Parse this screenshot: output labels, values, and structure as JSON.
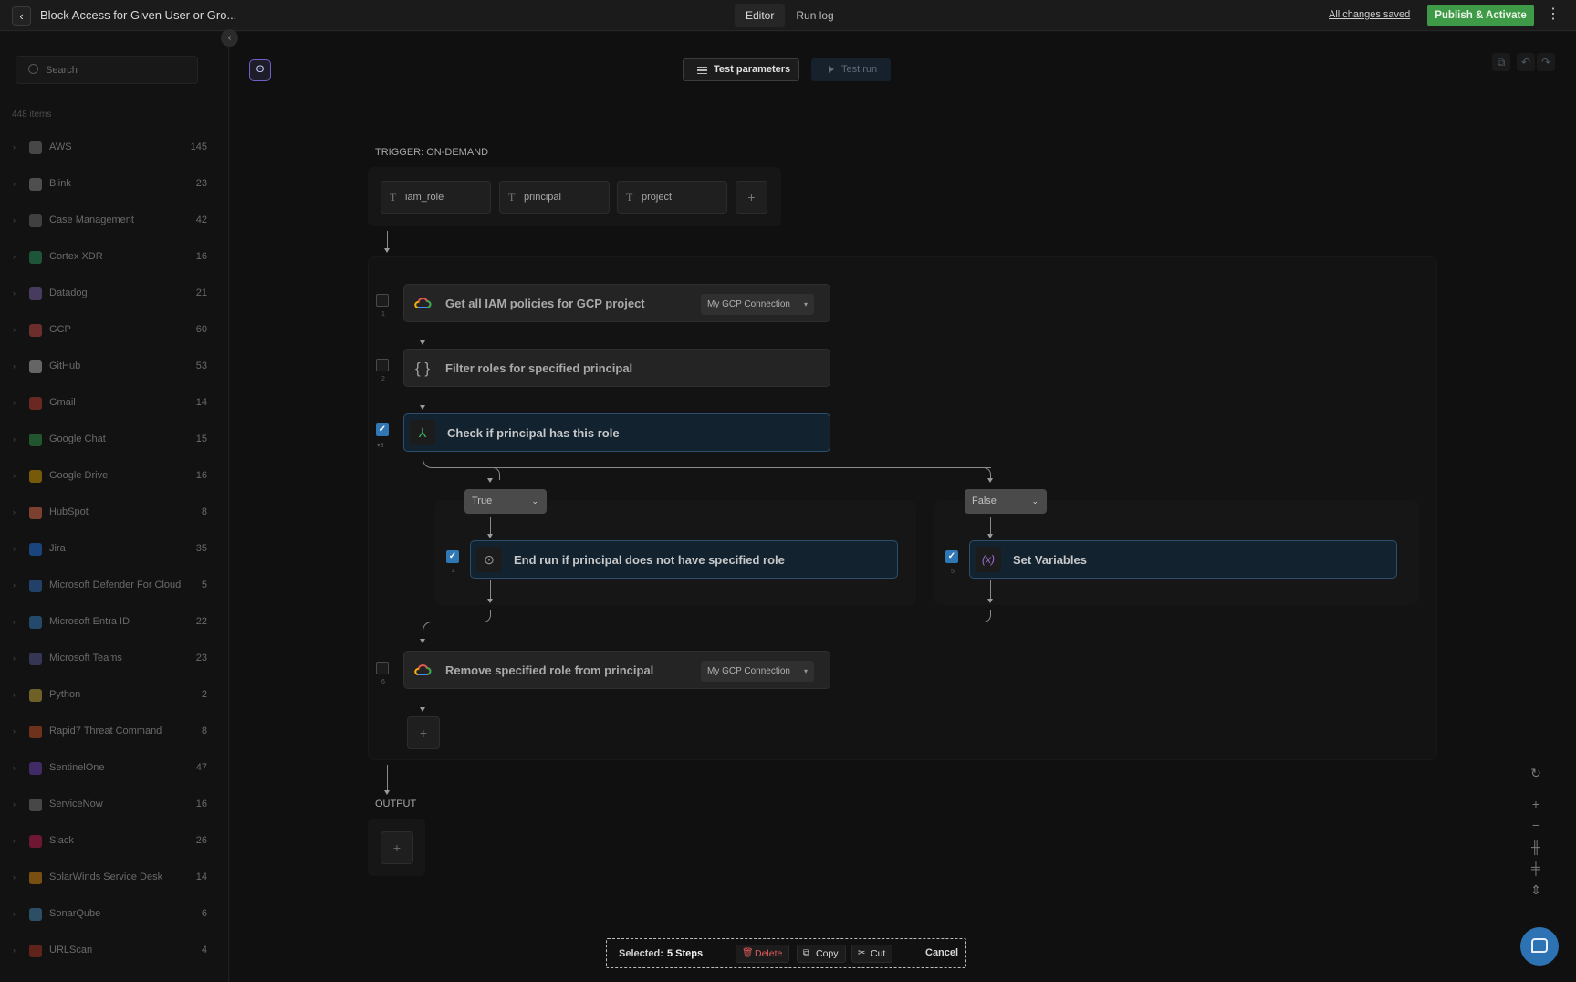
{
  "header": {
    "title": "Block Access for Given User or Gro...",
    "tabs": [
      {
        "label": "Editor",
        "active": true
      },
      {
        "label": "Run log",
        "active": false
      }
    ],
    "save_status": "All changes saved",
    "publish_label": "Publish & Activate",
    "publish_color": "#3f9a47",
    "more_icon": "⋮"
  },
  "sidebar": {
    "search_placeholder": "Search",
    "items_count": "448 items",
    "integrations": [
      {
        "name": "AWS",
        "count": "145",
        "color": "#8a8a8a"
      },
      {
        "name": "Blink",
        "count": "23",
        "color": "#9a9a9a"
      },
      {
        "name": "Case Management",
        "count": "42",
        "color": "#7a7a7a"
      },
      {
        "name": "Cortex XDR",
        "count": "16",
        "color": "#2fa86a"
      },
      {
        "name": "Datadog",
        "count": "21",
        "color": "#8a6fc0"
      },
      {
        "name": "GCP",
        "count": "60",
        "color": "#d9534f"
      },
      {
        "name": "GitHub",
        "count": "53",
        "color": "#cccccc"
      },
      {
        "name": "Gmail",
        "count": "14",
        "color": "#d44638"
      },
      {
        "name": "Google Chat",
        "count": "15",
        "color": "#34a853"
      },
      {
        "name": "Google Drive",
        "count": "16",
        "color": "#f4b400"
      },
      {
        "name": "HubSpot",
        "count": "8",
        "color": "#ff7a59"
      },
      {
        "name": "Jira",
        "count": "35",
        "color": "#2684ff"
      },
      {
        "name": "Microsoft Defender For Cloud",
        "count": "5",
        "color": "#3a7bd5"
      },
      {
        "name": "Microsoft Entra ID",
        "count": "22",
        "color": "#3b8fd9"
      },
      {
        "name": "Microsoft Teams",
        "count": "23",
        "color": "#6264a7"
      },
      {
        "name": "Python",
        "count": "2",
        "color": "#e0c040"
      },
      {
        "name": "Rapid7 Threat Command",
        "count": "8",
        "color": "#e05a2b"
      },
      {
        "name": "SentinelOne",
        "count": "47",
        "color": "#7b4bd1"
      },
      {
        "name": "ServiceNow",
        "count": "16",
        "color": "#8a8a8a"
      },
      {
        "name": "Slack",
        "count": "26",
        "color": "#e01e5a"
      },
      {
        "name": "SolarWinds Service Desk",
        "count": "14",
        "color": "#f39c12"
      },
      {
        "name": "SonarQube",
        "count": "6",
        "color": "#4e9bcd"
      },
      {
        "name": "URLScan",
        "count": "4",
        "color": "#c0392b"
      }
    ]
  },
  "canvas": {
    "test_parameters_label": "Test parameters",
    "test_run_label": "Test run",
    "trigger_label": "TRIGGER: ON-DEMAND",
    "trigger_params": [
      {
        "name": "iam_role"
      },
      {
        "name": "principal"
      },
      {
        "name": "project"
      }
    ],
    "add_symbol": "+",
    "steps": [
      {
        "num": "1",
        "label": "Get all IAM policies for GCP project",
        "connection": "My GCP Connection",
        "selected": false
      },
      {
        "num": "2",
        "label": "Filter roles for specified principal",
        "selected": false
      },
      {
        "num": "3",
        "label": "Check if principal has this role",
        "selected": true
      },
      {
        "num": "4",
        "label": "End run if principal does not have specified role",
        "selected": true
      },
      {
        "num": "5",
        "label": "Set Variables",
        "selected": true
      },
      {
        "num": "6",
        "label": "Remove specified role from principal",
        "connection": "My GCP Connection",
        "selected": false
      }
    ],
    "branches": [
      {
        "label": "True"
      },
      {
        "label": "False"
      }
    ],
    "output_label": "OUTPUT"
  },
  "selection_bar": {
    "selected_label": "Selected:",
    "selected_count": "5 Steps",
    "delete_label": "Delete",
    "copy_label": "Copy",
    "cut_label": "Cut",
    "cancel_label": "Cancel"
  },
  "icons": {
    "back": "chevron-left-icon",
    "search": "search-icon",
    "gcp": "gcp-cloud-icon",
    "filter": "curly-braces-icon",
    "condition": "branch-icon",
    "end": "stop-circle-icon",
    "variables": "variable-icon",
    "chat": "chat-icon"
  }
}
